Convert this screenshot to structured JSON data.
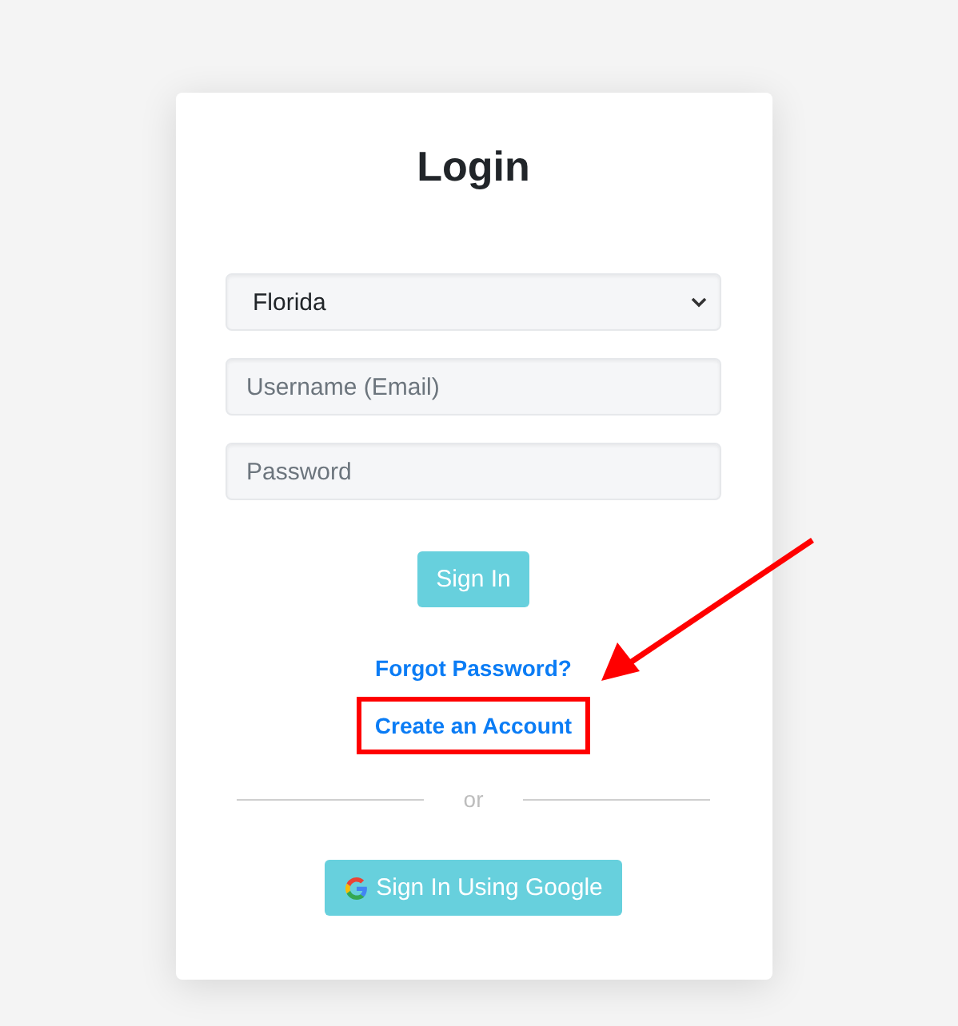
{
  "title": "Login",
  "state_select": {
    "value": "Florida"
  },
  "fields": [
    {
      "placeholder": "Username (Email)"
    },
    {
      "placeholder": "Password"
    }
  ],
  "sign_in_button": "Sign In",
  "links": [
    {
      "label": "Forgot Password?",
      "highlighted": false
    },
    {
      "label": "Create an Account",
      "highlighted": true
    }
  ],
  "divider_text": "or",
  "google_button": "Sign In Using Google"
}
